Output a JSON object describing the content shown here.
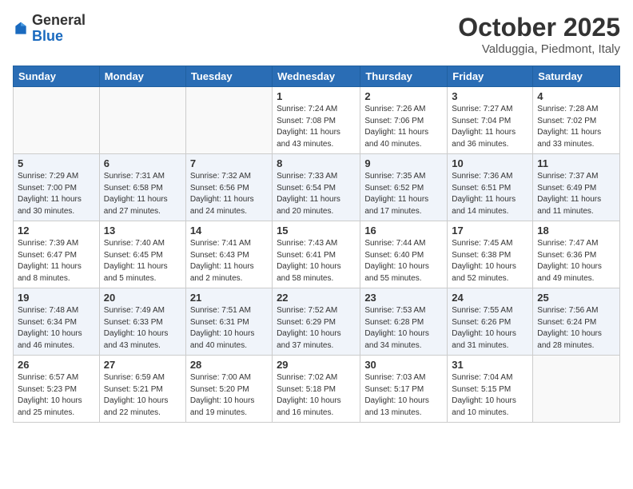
{
  "logo": {
    "general": "General",
    "blue": "Blue"
  },
  "header": {
    "month": "October 2025",
    "location": "Valduggia, Piedmont, Italy"
  },
  "weekdays": [
    "Sunday",
    "Monday",
    "Tuesday",
    "Wednesday",
    "Thursday",
    "Friday",
    "Saturday"
  ],
  "weeks": [
    [
      {
        "day": "",
        "info": ""
      },
      {
        "day": "",
        "info": ""
      },
      {
        "day": "",
        "info": ""
      },
      {
        "day": "1",
        "info": "Sunrise: 7:24 AM\nSunset: 7:08 PM\nDaylight: 11 hours\nand 43 minutes."
      },
      {
        "day": "2",
        "info": "Sunrise: 7:26 AM\nSunset: 7:06 PM\nDaylight: 11 hours\nand 40 minutes."
      },
      {
        "day": "3",
        "info": "Sunrise: 7:27 AM\nSunset: 7:04 PM\nDaylight: 11 hours\nand 36 minutes."
      },
      {
        "day": "4",
        "info": "Sunrise: 7:28 AM\nSunset: 7:02 PM\nDaylight: 11 hours\nand 33 minutes."
      }
    ],
    [
      {
        "day": "5",
        "info": "Sunrise: 7:29 AM\nSunset: 7:00 PM\nDaylight: 11 hours\nand 30 minutes."
      },
      {
        "day": "6",
        "info": "Sunrise: 7:31 AM\nSunset: 6:58 PM\nDaylight: 11 hours\nand 27 minutes."
      },
      {
        "day": "7",
        "info": "Sunrise: 7:32 AM\nSunset: 6:56 PM\nDaylight: 11 hours\nand 24 minutes."
      },
      {
        "day": "8",
        "info": "Sunrise: 7:33 AM\nSunset: 6:54 PM\nDaylight: 11 hours\nand 20 minutes."
      },
      {
        "day": "9",
        "info": "Sunrise: 7:35 AM\nSunset: 6:52 PM\nDaylight: 11 hours\nand 17 minutes."
      },
      {
        "day": "10",
        "info": "Sunrise: 7:36 AM\nSunset: 6:51 PM\nDaylight: 11 hours\nand 14 minutes."
      },
      {
        "day": "11",
        "info": "Sunrise: 7:37 AM\nSunset: 6:49 PM\nDaylight: 11 hours\nand 11 minutes."
      }
    ],
    [
      {
        "day": "12",
        "info": "Sunrise: 7:39 AM\nSunset: 6:47 PM\nDaylight: 11 hours\nand 8 minutes."
      },
      {
        "day": "13",
        "info": "Sunrise: 7:40 AM\nSunset: 6:45 PM\nDaylight: 11 hours\nand 5 minutes."
      },
      {
        "day": "14",
        "info": "Sunrise: 7:41 AM\nSunset: 6:43 PM\nDaylight: 11 hours\nand 2 minutes."
      },
      {
        "day": "15",
        "info": "Sunrise: 7:43 AM\nSunset: 6:41 PM\nDaylight: 10 hours\nand 58 minutes."
      },
      {
        "day": "16",
        "info": "Sunrise: 7:44 AM\nSunset: 6:40 PM\nDaylight: 10 hours\nand 55 minutes."
      },
      {
        "day": "17",
        "info": "Sunrise: 7:45 AM\nSunset: 6:38 PM\nDaylight: 10 hours\nand 52 minutes."
      },
      {
        "day": "18",
        "info": "Sunrise: 7:47 AM\nSunset: 6:36 PM\nDaylight: 10 hours\nand 49 minutes."
      }
    ],
    [
      {
        "day": "19",
        "info": "Sunrise: 7:48 AM\nSunset: 6:34 PM\nDaylight: 10 hours\nand 46 minutes."
      },
      {
        "day": "20",
        "info": "Sunrise: 7:49 AM\nSunset: 6:33 PM\nDaylight: 10 hours\nand 43 minutes."
      },
      {
        "day": "21",
        "info": "Sunrise: 7:51 AM\nSunset: 6:31 PM\nDaylight: 10 hours\nand 40 minutes."
      },
      {
        "day": "22",
        "info": "Sunrise: 7:52 AM\nSunset: 6:29 PM\nDaylight: 10 hours\nand 37 minutes."
      },
      {
        "day": "23",
        "info": "Sunrise: 7:53 AM\nSunset: 6:28 PM\nDaylight: 10 hours\nand 34 minutes."
      },
      {
        "day": "24",
        "info": "Sunrise: 7:55 AM\nSunset: 6:26 PM\nDaylight: 10 hours\nand 31 minutes."
      },
      {
        "day": "25",
        "info": "Sunrise: 7:56 AM\nSunset: 6:24 PM\nDaylight: 10 hours\nand 28 minutes."
      }
    ],
    [
      {
        "day": "26",
        "info": "Sunrise: 6:57 AM\nSunset: 5:23 PM\nDaylight: 10 hours\nand 25 minutes."
      },
      {
        "day": "27",
        "info": "Sunrise: 6:59 AM\nSunset: 5:21 PM\nDaylight: 10 hours\nand 22 minutes."
      },
      {
        "day": "28",
        "info": "Sunrise: 7:00 AM\nSunset: 5:20 PM\nDaylight: 10 hours\nand 19 minutes."
      },
      {
        "day": "29",
        "info": "Sunrise: 7:02 AM\nSunset: 5:18 PM\nDaylight: 10 hours\nand 16 minutes."
      },
      {
        "day": "30",
        "info": "Sunrise: 7:03 AM\nSunset: 5:17 PM\nDaylight: 10 hours\nand 13 minutes."
      },
      {
        "day": "31",
        "info": "Sunrise: 7:04 AM\nSunset: 5:15 PM\nDaylight: 10 hours\nand 10 minutes."
      },
      {
        "day": "",
        "info": ""
      }
    ]
  ]
}
